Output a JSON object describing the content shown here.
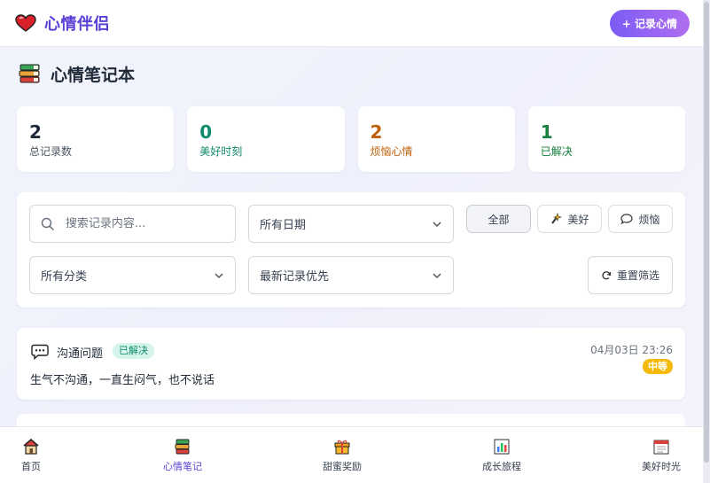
{
  "header": {
    "brand_icon": "heart-icon",
    "brand_title": "心情伴侣",
    "record_button": "+ 记录心情"
  },
  "page": {
    "title_icon": "books-icon",
    "title": "心情笔记本"
  },
  "stats": [
    {
      "value": "2",
      "label": "总记录数",
      "color": "#1f2937"
    },
    {
      "value": "0",
      "label": "美好时刻",
      "color": "#0f8a6b"
    },
    {
      "value": "2",
      "label": "烦恼心情",
      "color": "#c0600a"
    },
    {
      "value": "1",
      "label": "已解决",
      "color": "#15803d"
    }
  ],
  "filters": {
    "search_placeholder": "搜索记录内容...",
    "date_select": "所有日期",
    "category_select": "所有分类",
    "sort_select": "最新记录优先",
    "chips": [
      {
        "label": "全部",
        "icon": "",
        "active": true
      },
      {
        "label": "美好",
        "icon": "sparkle-icon",
        "active": false
      },
      {
        "label": "烦恼",
        "icon": "speech-bubble-icon",
        "active": false
      }
    ],
    "reset_button": "重置筛选"
  },
  "records": [
    {
      "category_icon": "chat-bubble-icon",
      "category": "沟通问题",
      "status": "已解决",
      "time": "04月03日 23:26",
      "level": "中等",
      "content": "生气不沟通，一直生闷气，也不说话"
    }
  ],
  "bottom_nav": [
    {
      "label": "首页",
      "icon": "house-icon",
      "active": false
    },
    {
      "label": "心情笔记",
      "icon": "books-icon",
      "active": true
    },
    {
      "label": "甜蜜奖励",
      "icon": "gift-icon",
      "active": false
    },
    {
      "label": "成长旅程",
      "icon": "chart-icon",
      "active": false
    },
    {
      "label": "美好时光",
      "icon": "calendar-icon",
      "active": false
    }
  ]
}
